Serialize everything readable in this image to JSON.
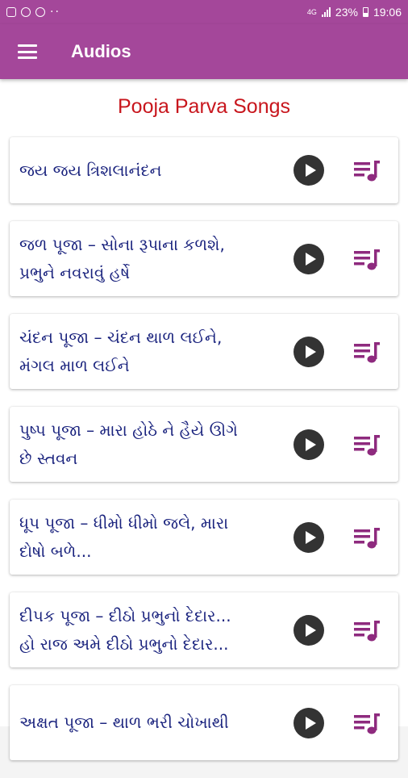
{
  "statusbar": {
    "battery": "23%",
    "time": "19:06",
    "network": "4G"
  },
  "appbar": {
    "title": "Audios",
    "menu_icon": "menu-icon"
  },
  "section": {
    "title": "Pooja Parva Songs"
  },
  "songs": [
    {
      "line1": "જય જય ત્રિશલાનંદન",
      "line2": ""
    },
    {
      "line1": "જળ પૂજા – સોના રૂપાના કળશે,",
      "line2": "પ્રભુને નવરાવું હર્ષે"
    },
    {
      "line1": "ચંદન પૂજા – ચંદન થાળ લઈને,",
      "line2": "મંગલ માળ લઈને"
    },
    {
      "line1": "પુષ્પ પૂજા – મારા હોઠે ને હૈયે ઊગે",
      "line2": "છે સ્તવન"
    },
    {
      "line1": "ધૂપ પૂજા – ધીમો ધીમો જલે, મારા",
      "line2": "દોષો બળે..."
    },
    {
      "line1": "દીપક પૂજા – દીઠો પ્રભુનો દેદાર...",
      "line2": "હો રાજ અમે દીઠો પ્રભુનો દેદાર..."
    },
    {
      "line1": "અક્ષત પૂજા – થાળ ભરી ચોખાથી",
      "line2": ""
    }
  ],
  "colors": {
    "primary": "#a4479a",
    "title_red": "#c8161d",
    "song_text": "#1a237e",
    "playlist_icon": "#8e2a7e"
  }
}
